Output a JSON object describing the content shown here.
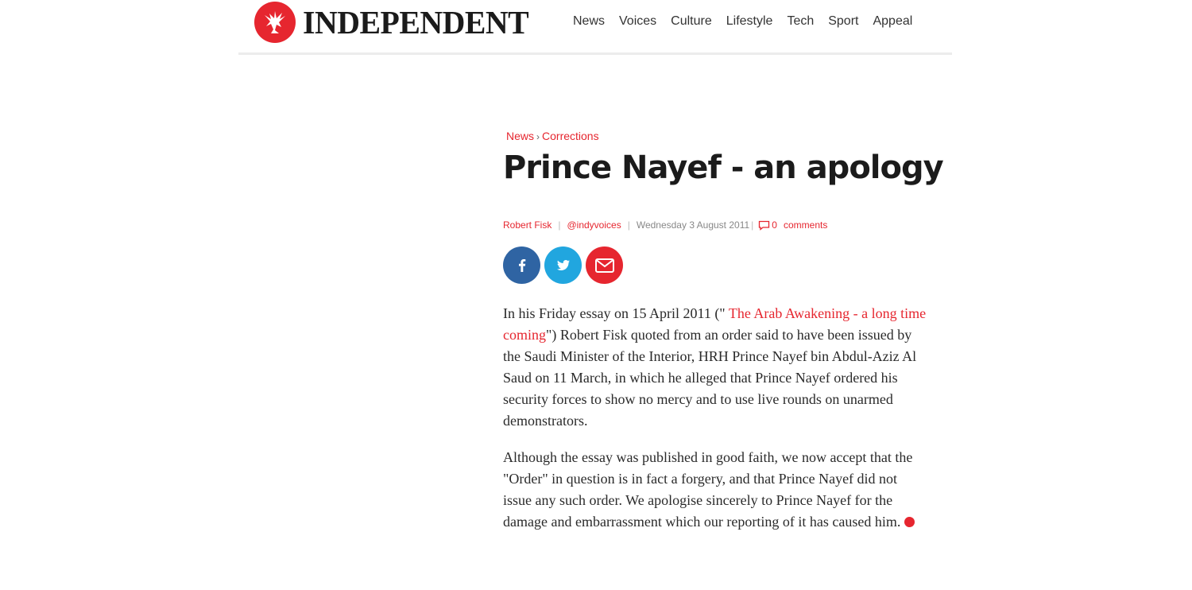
{
  "header": {
    "brand": "INDEPENDENT",
    "nav": [
      "News",
      "Voices",
      "Culture",
      "Lifestyle",
      "Tech",
      "Sport",
      "Appeal"
    ]
  },
  "breadcrumb": {
    "section": "News",
    "separator": "›",
    "subsection": "Corrections"
  },
  "article": {
    "title": "Prince Nayef - an apology",
    "author": "Robert Fisk",
    "handle": "@indyvoices",
    "date": "Wednesday 3 August 2011",
    "comment_count": "0",
    "comments_label": "comments",
    "p1_lead": "In his Friday essay on 15 April 2011 (\"",
    "p1_link": " The Arab Awakening - a long time coming",
    "p1_rest": "\") Robert Fisk quoted from an order said to have been issued by the Saudi Minister of the Interior, HRH Prince Nayef bin Abdul-Aziz Al Saud on 11 March, in which he alleged that Prince Nayef ordered his security forces to show no mercy and to use live rounds on unarmed demonstrators.",
    "p2": "Although the essay was published in good faith, we now accept that the \"Order\" in question is in fact a forgery, and that Prince Nayef did not issue any such order. We apologise sincerely to Prince Nayef for the damage and embarrassment which our reporting of it has caused him."
  },
  "share": {
    "icons": [
      "facebook-icon",
      "twitter-icon",
      "email-icon"
    ]
  },
  "colors": {
    "brand_red": "#e6262f",
    "facebook": "#2f64a3",
    "twitter": "#21a6df"
  }
}
